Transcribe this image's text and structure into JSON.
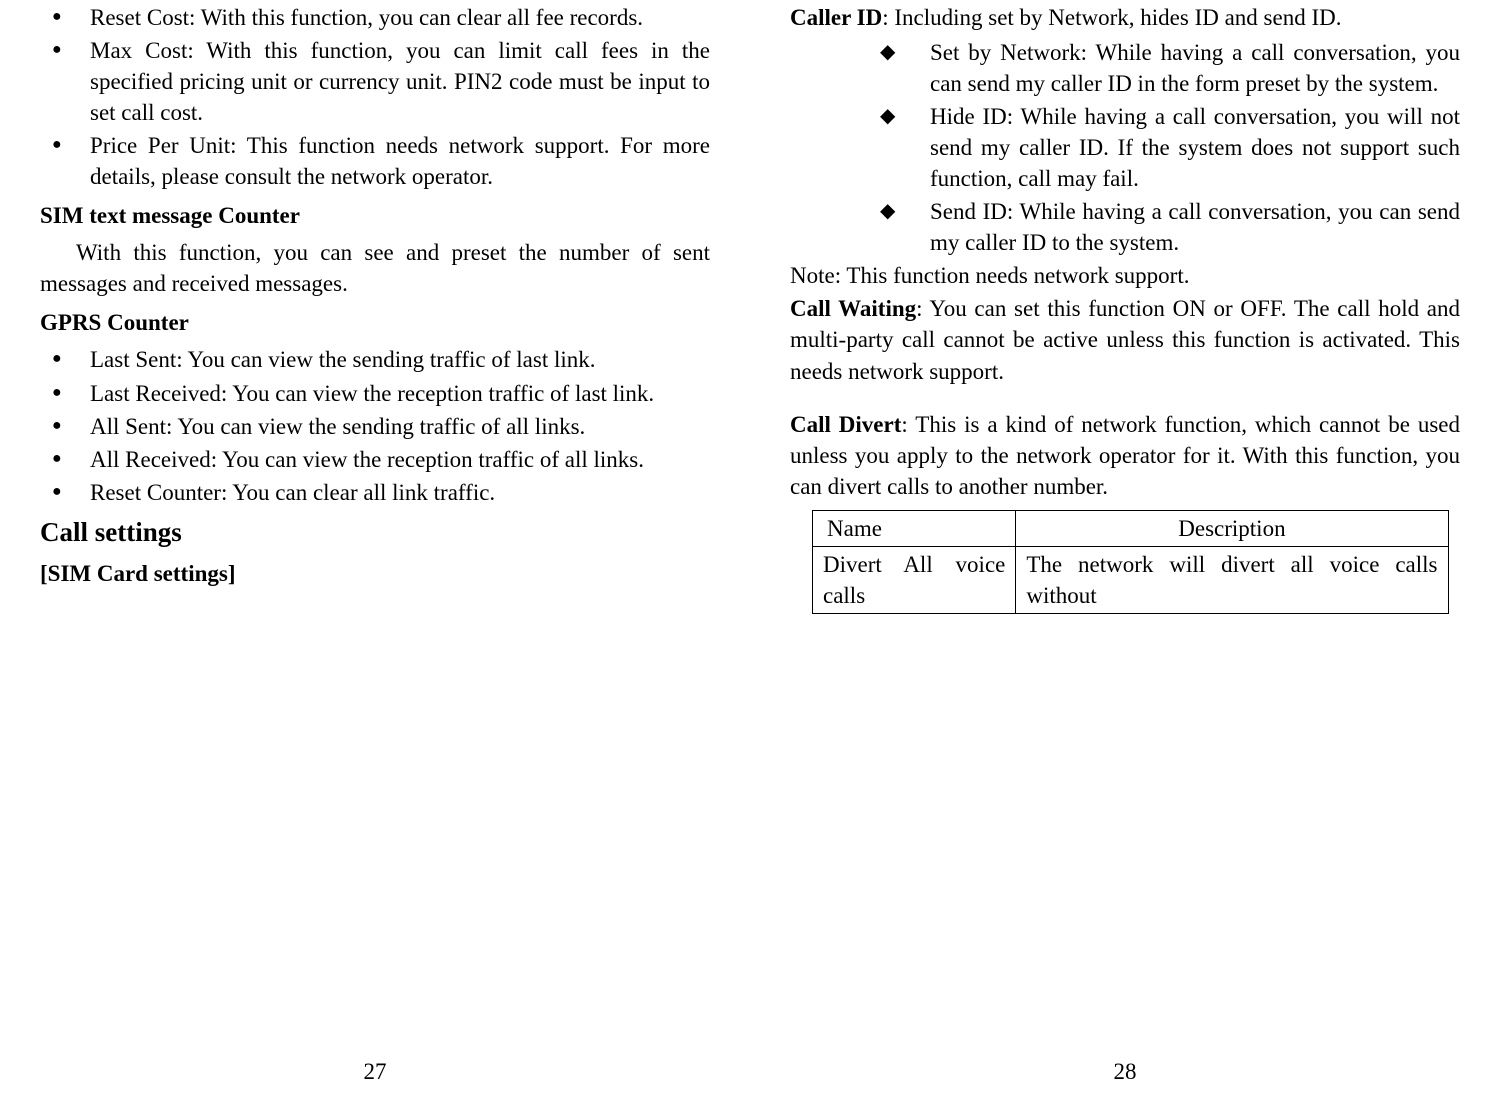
{
  "leftPage": {
    "bullets1": [
      "Reset Cost: With this function, you can clear all fee records.",
      "Max Cost: With this function, you can limit call fees in the specified pricing unit or currency unit. PIN2 code must be input to set call cost.",
      "Price Per Unit: This function needs network support. For more details, please consult the network operator."
    ],
    "heading1": "SIM text message Counter",
    "para1": "With this function, you can see and preset the number of sent messages and received messages.",
    "heading2": "GPRS Counter",
    "bullets2": [
      "Last Sent: You can view the sending traffic of last link.",
      "Last Received: You can view the reception traffic of last link.",
      "All Sent: You can view the sending traffic of all links.",
      "All Received: You can view the reception traffic of all links.",
      "Reset Counter: You can clear all link traffic."
    ],
    "heading3": "Call settings",
    "heading4": "[SIM Card settings]",
    "pageNum": "27"
  },
  "rightPage": {
    "callerIdLabel": "Caller ID",
    "callerIdText": ": Including set by Network, hides ID and send ID.",
    "diamonds": [
      "Set by Network: While having a call conversation, you can send my caller ID in the form preset by the system.",
      "Hide ID: While having a call conversation, you will not send my caller ID. If the system does not support such function, call may fail.",
      "Send ID: While having a call conversation, you can send my caller ID to the system."
    ],
    "note": "Note: This function needs network support.",
    "callWaitingLabel": "Call Waiting",
    "callWaitingText": ": You can set this function ON or OFF. The call hold and multi-party call cannot be active unless this function is activated. This needs network support.",
    "callDivertLabel": "Call Divert",
    "callDivertText": ": This is a kind of network function, which cannot be used unless you apply to the network operator for it. With this function, you can divert calls to another number.",
    "table": {
      "headerCol1": "Name",
      "headerCol2": "Description",
      "row1Col1": "Divert All voice calls",
      "row1Col2": "The network will divert all voice calls without"
    },
    "pageNum": "28"
  }
}
